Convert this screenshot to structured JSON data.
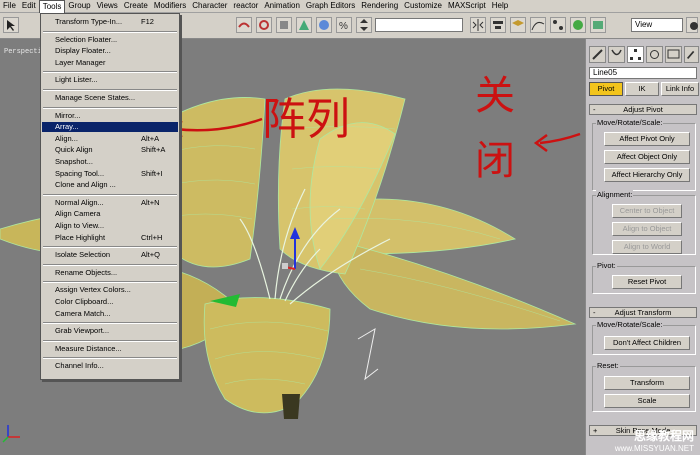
{
  "menubar": {
    "items": [
      "File",
      "Edit",
      "Tools",
      "Group",
      "Views",
      "Create",
      "Modifiers",
      "Character",
      "reactor",
      "Animation",
      "Graph Editors",
      "Rendering",
      "Customize",
      "MAXScript",
      "Help"
    ]
  },
  "toolbar": {
    "view_select": "View"
  },
  "viewport": {
    "label": "Perspective"
  },
  "tools_menu": [
    {
      "label": "Transform Type-In...",
      "shortcut": "F12"
    },
    {
      "sep": true
    },
    {
      "label": "Selection Floater...",
      "shortcut": ""
    },
    {
      "label": "Display Floater...",
      "shortcut": ""
    },
    {
      "label": "Layer Manager",
      "shortcut": ""
    },
    {
      "sep": true
    },
    {
      "label": "Light Lister...",
      "shortcut": ""
    },
    {
      "sep": true
    },
    {
      "label": "Manage Scene States...",
      "shortcut": ""
    },
    {
      "sep": true
    },
    {
      "label": "Mirror...",
      "shortcut": ""
    },
    {
      "label": "Array...",
      "shortcut": "",
      "highlighted": true
    },
    {
      "label": "Align...",
      "shortcut": "Alt+A"
    },
    {
      "label": "Quick Align",
      "shortcut": "Shift+A"
    },
    {
      "label": "Snapshot...",
      "shortcut": ""
    },
    {
      "label": "Spacing Tool...",
      "shortcut": "Shift+I"
    },
    {
      "label": "Clone and Align ...",
      "shortcut": ""
    },
    {
      "sep": true
    },
    {
      "label": "Normal Align...",
      "shortcut": "Alt+N"
    },
    {
      "label": "Align Camera",
      "shortcut": ""
    },
    {
      "label": "Align to View...",
      "shortcut": ""
    },
    {
      "label": "Place Highlight",
      "shortcut": "Ctrl+H"
    },
    {
      "sep": true
    },
    {
      "label": "Isolate Selection",
      "shortcut": "Alt+Q"
    },
    {
      "sep": true
    },
    {
      "label": "Rename Objects...",
      "shortcut": ""
    },
    {
      "sep": true
    },
    {
      "label": "Assign Vertex Colors...",
      "shortcut": ""
    },
    {
      "label": "Color Clipboard...",
      "shortcut": ""
    },
    {
      "label": "Camera Match...",
      "shortcut": ""
    },
    {
      "sep": true
    },
    {
      "label": "Grab Viewport...",
      "shortcut": ""
    },
    {
      "sep": true
    },
    {
      "label": "Measure Distance...",
      "shortcut": ""
    },
    {
      "sep": true
    },
    {
      "label": "Channel Info...",
      "shortcut": ""
    }
  ],
  "annotations": {
    "array_note": "阵列",
    "close_note": "关闭"
  },
  "panel": {
    "object_name": "Line05",
    "tabs": [
      "Pivot",
      "IK",
      "Link Info"
    ],
    "adjust_pivot": {
      "title": "Adjust Pivot",
      "move_label": "Move/Rotate/Scale:",
      "buttons": [
        "Affect Pivot Only",
        "Affect Object Only",
        "Affect Hierarchy Only"
      ],
      "alignment_label": "Alignment:",
      "align_buttons": [
        "Center to Object",
        "Align to Object",
        "Align to World"
      ],
      "pivot_label": "Pivot:",
      "reset_pivot": "Reset Pivot"
    },
    "adjust_transform": {
      "title": "Adjust Transform",
      "move_label": "Move/Rotate/Scale:",
      "dont_affect": "Don't Affect Children",
      "reset_label": "Reset:",
      "transform": "Transform",
      "scale": "Scale"
    },
    "skin_pose_title": "Skin Pose Mode"
  },
  "watermark": {
    "cn": "思缘教程网",
    "url": "www.MISSYUAN.NET"
  },
  "colors": {
    "accent": "#f2c41c",
    "highlight": "#0a246a",
    "annotation": "#cc1111",
    "petal": "#c8b65a"
  }
}
